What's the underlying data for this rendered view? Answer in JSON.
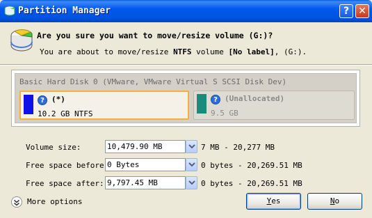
{
  "window": {
    "title": "Partition Manager"
  },
  "titlebar": {
    "help_glyph": "?",
    "close_glyph": "✕"
  },
  "dialog": {
    "question": "Are you sure you want to move/resize volume (G:)?",
    "detail_prefix": "You are about to move/resize ",
    "detail_fs": "NTFS",
    "detail_mid": " volume ",
    "detail_label": "[No label]",
    "detail_suffix": ", (G:)."
  },
  "disk": {
    "title": "Basic Hard Disk 0 (VMware, VMware Virtual S SCSI Disk Dev)",
    "partitions": [
      {
        "label": "(*)",
        "size": "10.2 GB NTFS",
        "color": "#1010e8",
        "icon": "help-icon"
      },
      {
        "label": "(Unallocated)",
        "size": "9.5 GB",
        "color": "#1a8a7a",
        "icon": "help-icon"
      }
    ]
  },
  "fields": {
    "volume_size": {
      "label": "Volume size:",
      "value": "10,479.90 MB",
      "range": "7 MB - 20,277 MB"
    },
    "free_before": {
      "label": "Free space before:",
      "value": "0 Bytes",
      "range": "0 bytes - 20,269.51 MB"
    },
    "free_after": {
      "label": "Free space after:",
      "value": "9,797.45 MB",
      "range": "0 bytes - 20,269.51 MB"
    }
  },
  "footer": {
    "more_options": "More options",
    "yes_first": "Y",
    "yes_rest": "es",
    "no_first": "N",
    "no_rest": "o"
  },
  "icons": {
    "more": "double-chevron-down-icon",
    "spin": "spin-arrows-icon",
    "dropdown": "chevron-down-icon"
  }
}
